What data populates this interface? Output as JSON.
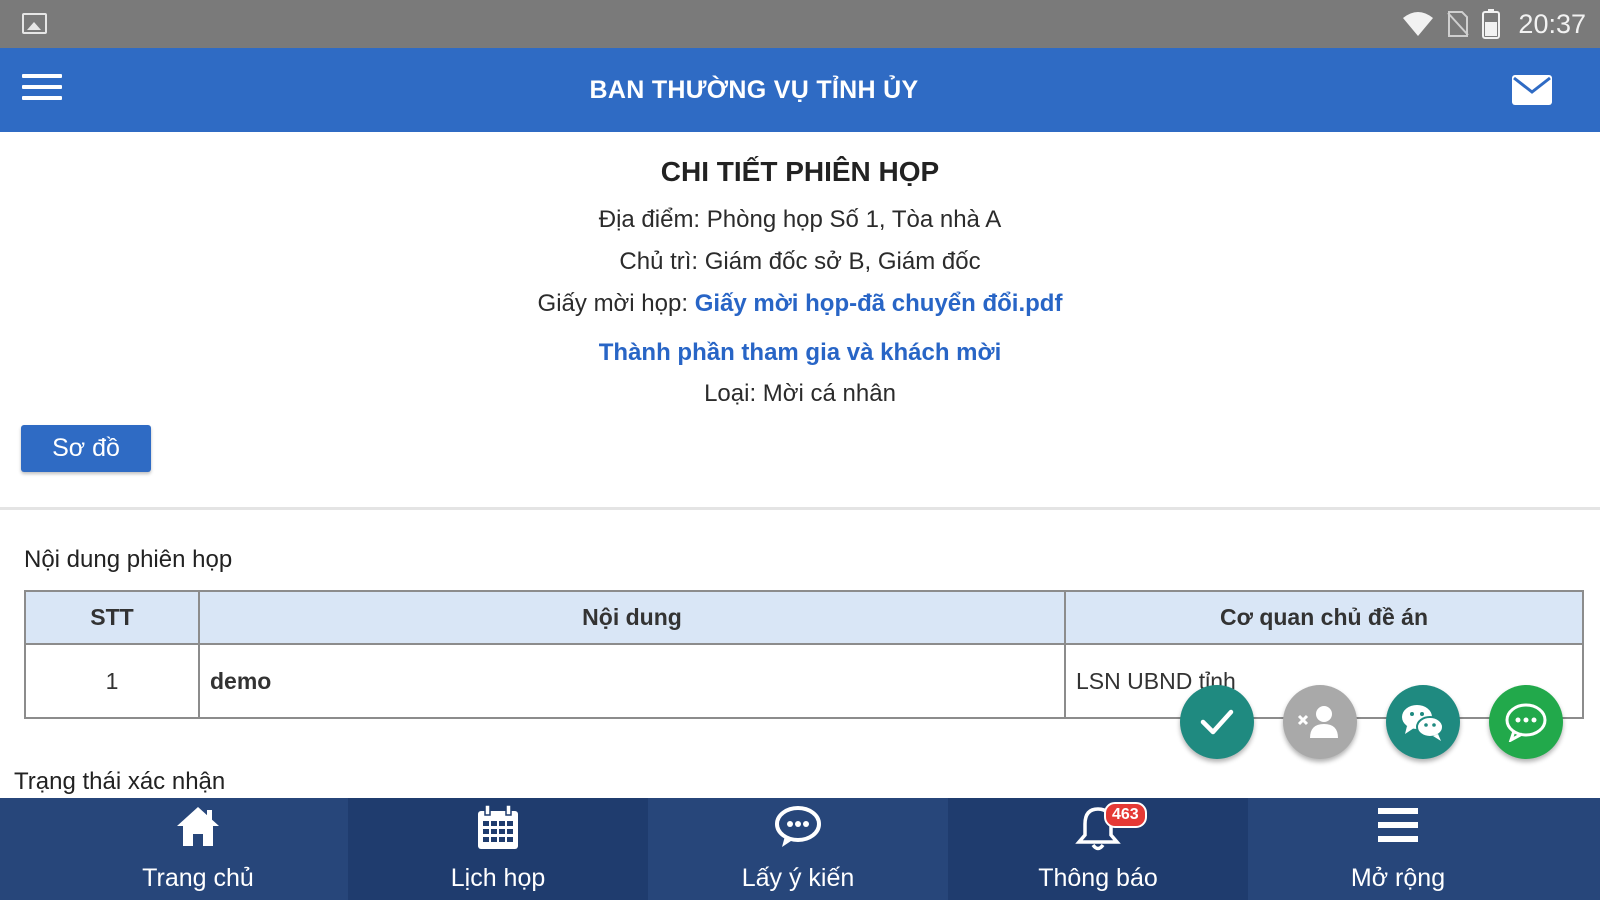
{
  "status_bar": {
    "time": "20:37"
  },
  "app_bar": {
    "title": "BAN THƯỜNG VỤ TỈNH ỦY"
  },
  "detail": {
    "title": "CHI TIẾT PHIÊN HỌP",
    "location": "Địa điểm: Phòng họp Số 1, Tòa nhà A",
    "chair": "Chủ trì: Giám đốc sở B, Giám đốc",
    "invitation_label": "Giấy mời họp:",
    "invitation_file": "Giấy mời họp-đã chuyển đổi.pdf",
    "participants_link": "Thành phần tham gia và khách mời",
    "type": "Loại: Mời cá nhân",
    "map_button": "Sơ đồ"
  },
  "agenda": {
    "title": "Nội dung phiên họp",
    "columns": [
      "STT",
      "Nội dung",
      "Cơ quan chủ đề án"
    ],
    "rows": [
      {
        "stt": "1",
        "content": "demo",
        "agency": "LSN UBND tỉnh"
      }
    ]
  },
  "confirmation": {
    "title": "Trạng thái xác nhận"
  },
  "fabs": {
    "confirm_icon": "check-icon",
    "decline_icon": "person-remove-icon",
    "wechat_icon": "wechat-icon",
    "chat_icon": "chat-bubble-icon",
    "colors": {
      "teal": "#1f8a80",
      "gray": "#a9a9a9",
      "green": "#22a94b"
    }
  },
  "bottom_nav": {
    "items": [
      {
        "label": "Trang chủ",
        "icon": "home-icon"
      },
      {
        "label": "Lịch họp",
        "icon": "calendar-icon"
      },
      {
        "label": "Lấy ý kiến",
        "icon": "comment-icon"
      },
      {
        "label": "Thông báo",
        "icon": "bell-icon",
        "badge": "463"
      },
      {
        "label": "Mở rộng",
        "icon": "menu-icon"
      }
    ]
  },
  "colors": {
    "primary": "#2f6bc4",
    "nav": "#27467a",
    "link": "#2865c6",
    "table_header": "#d9e6f6"
  }
}
